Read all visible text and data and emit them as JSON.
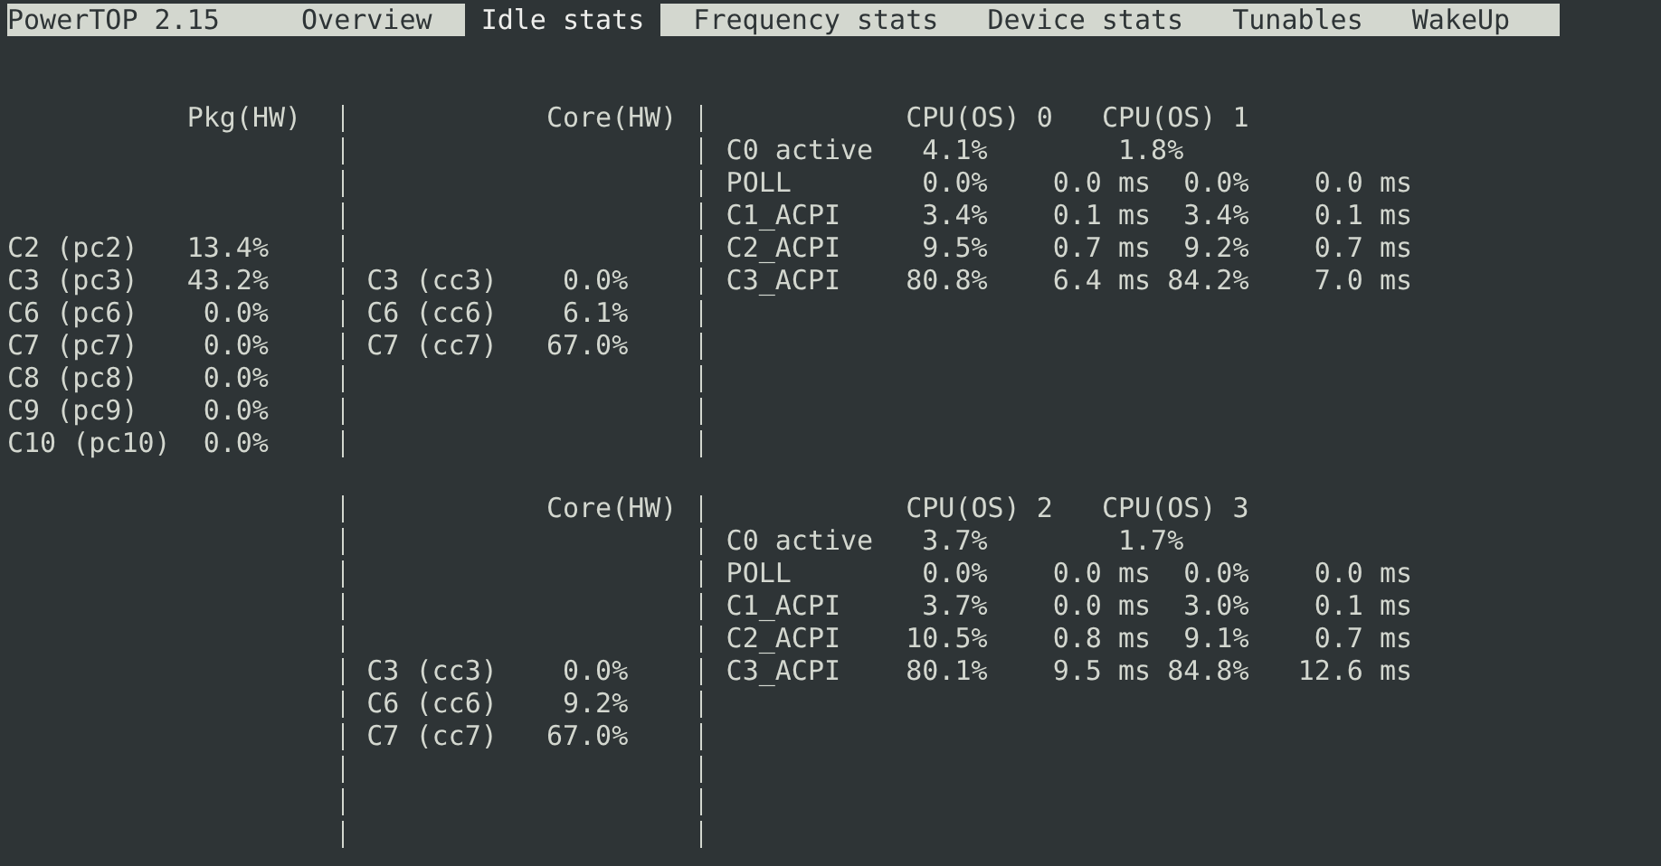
{
  "menu_bar": {
    "title": "PowerTOP 2.15",
    "tabs": [
      {
        "label": "Overview",
        "selected": false
      },
      {
        "label": "Idle stats",
        "selected": true
      },
      {
        "label": "Frequency stats",
        "selected": false
      },
      {
        "label": "Device stats",
        "selected": false
      },
      {
        "label": "Tunables",
        "selected": false
      },
      {
        "label": "WakeUp",
        "selected": false
      }
    ]
  },
  "blocks": [
    {
      "pkg_header": "Pkg(HW)",
      "pkg_rows": [
        {
          "label": "C2 (pc2)",
          "value": "13.4%"
        },
        {
          "label": "C3 (pc3)",
          "value": "43.2%"
        },
        {
          "label": "C6 (pc6)",
          "value": "0.0%"
        },
        {
          "label": "C7 (pc7)",
          "value": "0.0%"
        },
        {
          "label": "C8 (pc8)",
          "value": "0.0%"
        },
        {
          "label": "C9 (pc9)",
          "value": "0.0%"
        },
        {
          "label": "C10 (pc10)",
          "value": "0.0%"
        }
      ],
      "core_header": "Core(HW)",
      "core_rows": [
        {
          "label": "C3 (cc3)",
          "value": "0.0%"
        },
        {
          "label": "C6 (cc6)",
          "value": "6.1%"
        },
        {
          "label": "C7 (cc7)",
          "value": "67.0%"
        }
      ],
      "cpu_headers": [
        "CPU(OS) 0",
        "CPU(OS) 1"
      ],
      "cpu_rows": [
        {
          "kind": "summary",
          "label": "C0 active",
          "cells": [
            "4.1%",
            "1.8%"
          ]
        },
        {
          "kind": "state",
          "label": "POLL",
          "cells": [
            "0.0%",
            "0.0 ms",
            "0.0%",
            "0.0 ms"
          ]
        },
        {
          "kind": "state",
          "label": "C1_ACPI",
          "cells": [
            "3.4%",
            "0.1 ms",
            "3.4%",
            "0.1 ms"
          ]
        },
        {
          "kind": "state",
          "label": "C2_ACPI",
          "cells": [
            "9.5%",
            "0.7 ms",
            "9.2%",
            "0.7 ms"
          ]
        },
        {
          "kind": "state",
          "label": "C3_ACPI",
          "cells": [
            "80.8%",
            "6.4 ms",
            "84.2%",
            "7.0 ms"
          ]
        }
      ]
    },
    {
      "core_header": "Core(HW)",
      "core_rows": [
        {
          "label": "C3 (cc3)",
          "value": "0.0%"
        },
        {
          "label": "C6 (cc6)",
          "value": "9.2%"
        },
        {
          "label": "C7 (cc7)",
          "value": "67.0%"
        }
      ],
      "cpu_headers": [
        "CPU(OS) 2",
        "CPU(OS) 3"
      ],
      "cpu_rows": [
        {
          "kind": "summary",
          "label": "C0 active",
          "cells": [
            "3.7%",
            "1.7%"
          ]
        },
        {
          "kind": "state",
          "label": "POLL",
          "cells": [
            "0.0%",
            "0.0 ms",
            "0.0%",
            "0.0 ms"
          ]
        },
        {
          "kind": "state",
          "label": "C1_ACPI",
          "cells": [
            "3.7%",
            "0.0 ms",
            "3.0%",
            "0.1 ms"
          ]
        },
        {
          "kind": "state",
          "label": "C2_ACPI",
          "cells": [
            "10.5%",
            "0.8 ms",
            "9.1%",
            "0.7 ms"
          ]
        },
        {
          "kind": "state",
          "label": "C3_ACPI",
          "cells": [
            "80.1%",
            "9.5 ms",
            "84.8%",
            "12.6 ms"
          ]
        }
      ]
    }
  ]
}
